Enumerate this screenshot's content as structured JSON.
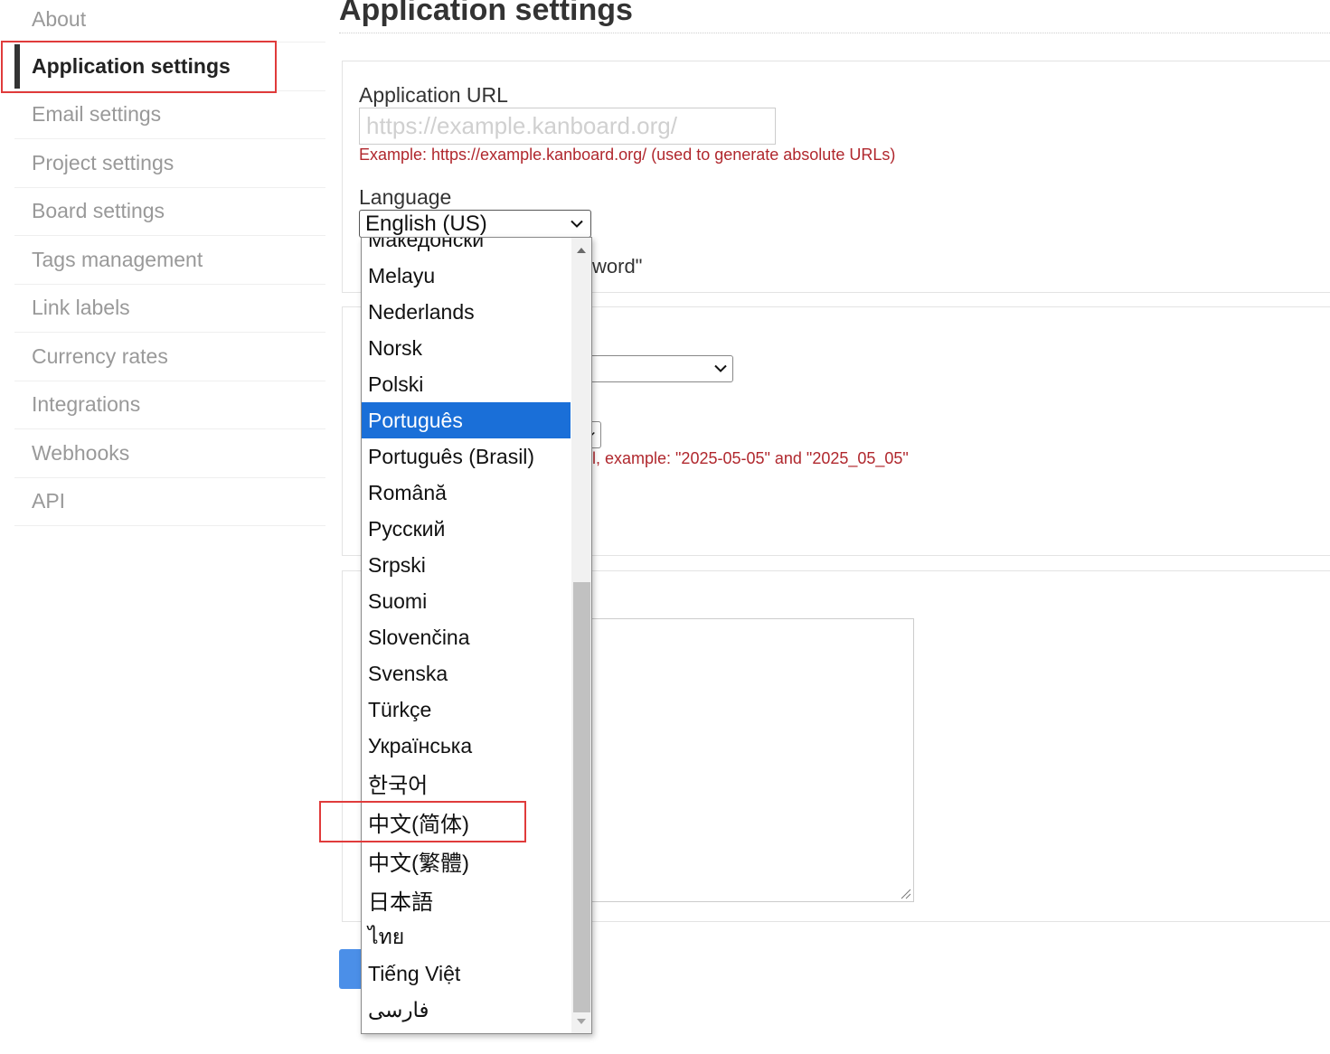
{
  "sidebar": {
    "items": [
      {
        "label": "About"
      },
      {
        "label": "Application settings"
      },
      {
        "label": "Email settings"
      },
      {
        "label": "Project settings"
      },
      {
        "label": "Board settings"
      },
      {
        "label": "Tags management"
      },
      {
        "label": "Link labels"
      },
      {
        "label": "Currency rates"
      },
      {
        "label": "Integrations"
      },
      {
        "label": "Webhooks"
      },
      {
        "label": "API"
      }
    ],
    "active_index": 1
  },
  "main": {
    "title": "Application settings",
    "app_url": {
      "label": "Application URL",
      "placeholder": "https://example.kanboard.org/",
      "hint": "Example: https://example.kanboard.org/ (used to generate absolute URLs)"
    },
    "language": {
      "label": "Language",
      "selected_value": "English (US)"
    },
    "partial_texts": {
      "word_quote": "word\"",
      "date_hint": "l, example: \"2025-05-05\" and \"2025_05_05\""
    }
  },
  "dropdown": {
    "options": [
      "Македонски",
      "Melayu",
      "Nederlands",
      "Norsk",
      "Polski",
      "Português",
      "Português (Brasil)",
      "Română",
      "Русский",
      "Srpski",
      "Suomi",
      "Slovenčina",
      "Svenska",
      "Türkçe",
      "Українська",
      "한국어",
      "中文(简体)",
      "中文(繁體)",
      "日本語",
      "ไทย",
      "Tiếng Việt",
      "فارسی"
    ],
    "highlighted_option": "Português"
  },
  "colors": {
    "accent": "#1a6fd8",
    "hint_red": "#b0272d",
    "annotation_red": "#e03b3b",
    "button_blue": "#4b8fe8"
  }
}
